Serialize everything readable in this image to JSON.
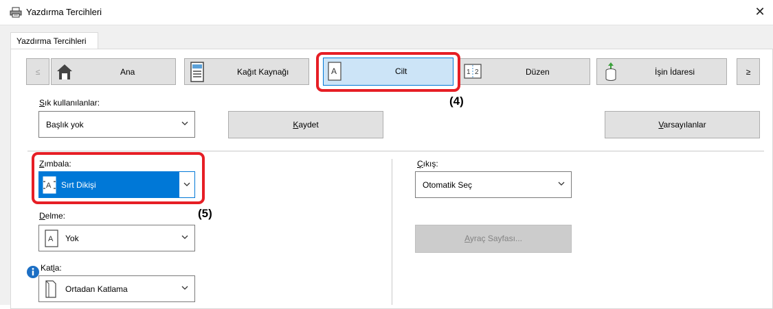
{
  "window": {
    "title": "Yazdırma Tercihleri",
    "close_icon": "close-icon"
  },
  "tab": {
    "label": "Yazdırma Tercihleri"
  },
  "nav": {
    "prev": "≤",
    "next": "≥",
    "items": [
      {
        "label": "Ana",
        "icon": "home-icon"
      },
      {
        "label": "Kağıt Kaynağı",
        "icon": "paper-tray-icon"
      },
      {
        "label": "Cilt",
        "icon": "page-icon",
        "active": true
      },
      {
        "label": "Düzen",
        "icon": "layout-icon",
        "icon_text": "1 2"
      },
      {
        "label": "İşin İdaresi",
        "icon": "job-stack-icon"
      }
    ]
  },
  "favorites": {
    "label": "Sık kullanılanlar:",
    "label_accel": "S",
    "label_rest": "ık kullanılanlar:",
    "value": "Başlık yok",
    "save_button": "Kaydet",
    "save_accel": "K",
    "save_rest": "aydet",
    "defaults_button": "Varsayılanlar",
    "defaults_accel": "V",
    "defaults_rest": "arsayılanlar"
  },
  "staple": {
    "label_accel": "Z",
    "label_rest": "ımbala:",
    "value": "Sırt Dikişi"
  },
  "punch": {
    "label_accel": "D",
    "label_rest": "elme:",
    "value": "Yok"
  },
  "fold": {
    "label_pre": "Kat",
    "label_accel": "l",
    "label_rest": "a:",
    "value": "Ortadan Katlama"
  },
  "output": {
    "label_accel": "Ç",
    "label_rest": "ıkış:",
    "value": "Otomatik Seç",
    "separator_button": "Ayraç Sayfası...",
    "separator_accel": "A",
    "separator_rest": "yraç Sayfası..."
  },
  "callouts": {
    "four": "(4)",
    "five": "(5)"
  },
  "colors": {
    "highlight": "#e61e25",
    "accent": "#0078d7",
    "active_tab_bg": "#cce4f7",
    "info": "#1c6fc4"
  }
}
